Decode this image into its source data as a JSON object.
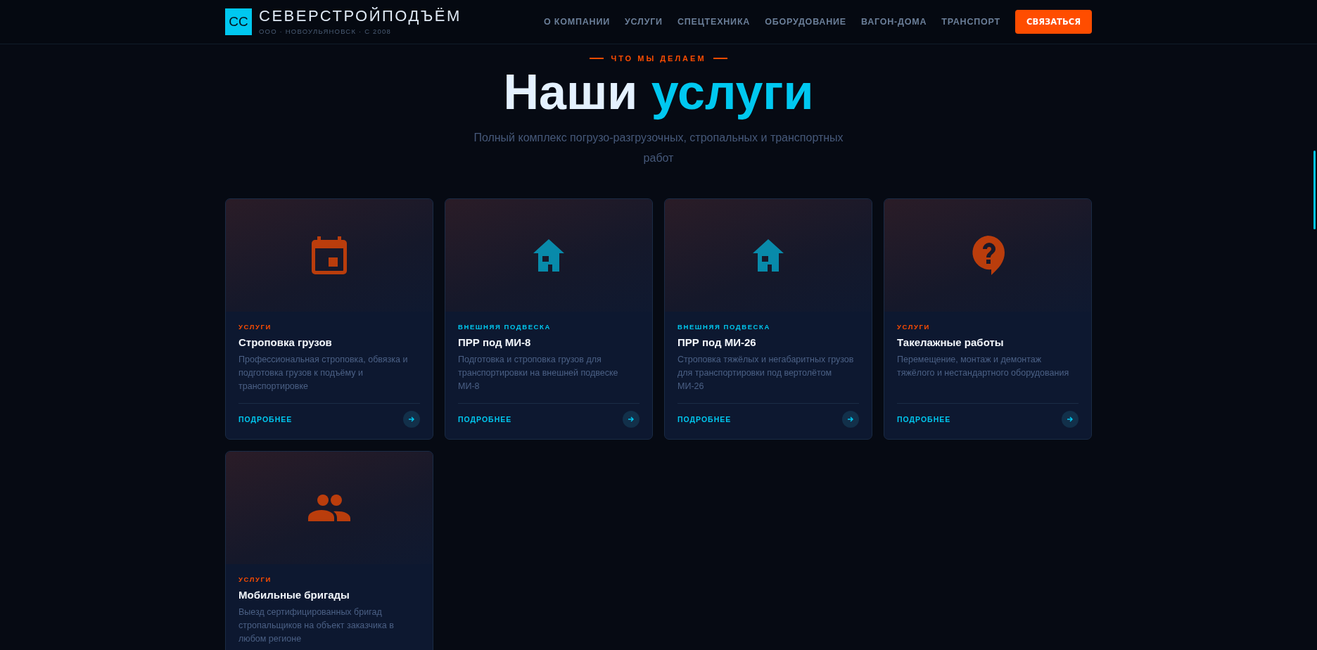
{
  "header": {
    "logo_mark": "СС",
    "brand": "СЕВЕРСТРОЙПОДЪЁМ",
    "tagline": "ООО · НОВОУЛЬЯНОВСК · С 2008",
    "nav": [
      {
        "label": "О КОМПАНИИ"
      },
      {
        "label": "УСЛУГИ"
      },
      {
        "label": "СПЕЦТЕХНИКА"
      },
      {
        "label": "ОБОРУДОВАНИЕ"
      },
      {
        "label": "ВАГОН-ДОМА"
      },
      {
        "label": "ТРАНСПОРТ"
      }
    ],
    "cta": "СВЯЗАТЬСЯ"
  },
  "section": {
    "eyebrow": "ЧТО МЫ ДЕЛАЕМ",
    "title_plain": "Наши",
    "title_accent": "услуги",
    "subtitle": "Полный комплекс погрузо-разгрузочных, стропальных и транспортных работ"
  },
  "cards": [
    {
      "kind": "calendar",
      "color": "#ff4d00",
      "tag": "УСЛУГИ",
      "title": "Строповка грузов",
      "description": "Профессиональная строповка, обвязка и подготовка грузов к подъёму и транспортировке",
      "link": "ПОДРОБНЕЕ"
    },
    {
      "kind": "house",
      "color": "#00c8f0",
      "tag": "ВНЕШНЯЯ ПОДВЕСКА",
      "title": "ПРР под МИ-8",
      "description": "Подготовка и строповка грузов для транспортировки на внешней подвеске МИ-8",
      "link": "ПОДРОБНЕЕ"
    },
    {
      "kind": "house",
      "color": "#00c8f0",
      "tag": "ВНЕШНЯЯ ПОДВЕСКА",
      "title": "ПРР под МИ-26",
      "description": "Строповка тяжёлых и негабаритных грузов для транспортировки под вертолётом МИ-26",
      "link": "ПОДРОБНЕЕ"
    },
    {
      "kind": "question",
      "color": "#ff4d00",
      "tag": "УСЛУГИ",
      "title": "Такелажные работы",
      "description": "Перемещение, монтаж и демонтаж тяжёлого и нестандартного оборудования",
      "link": "ПОДРОБНЕЕ"
    },
    {
      "kind": "people",
      "color": "#ff4d00",
      "tag": "УСЛУГИ",
      "title": "Мобильные бригады",
      "description": "Выезд сертифицированных бригад стропальщиков на объект заказчика в любом регионе"
    }
  ]
}
